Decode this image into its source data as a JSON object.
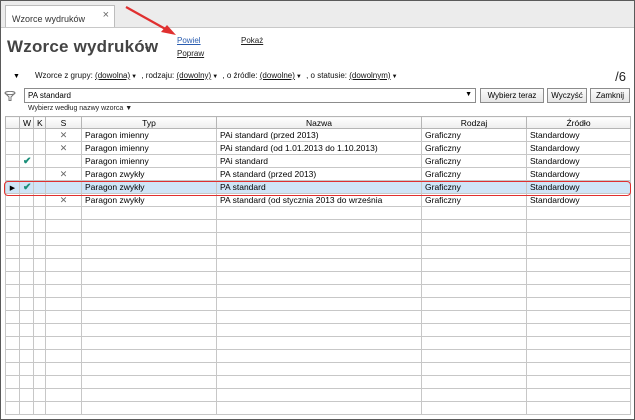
{
  "tab": {
    "label": "Wzorce wydruków",
    "close": "×"
  },
  "header": {
    "title": "Wzorce wydruków",
    "title_caret": "▾"
  },
  "actions": {
    "duplicate": "Powiel",
    "edit": "Popraw",
    "show": "Pokaż"
  },
  "page_count": "/6",
  "filters": {
    "group_label": "Wzorce z grupy:",
    "group_value": "(dowolna)",
    "type_label": ", rodzaju:",
    "type_value": "(dowolny)",
    "source_label": ", o źródle:",
    "source_value": "(dowolne)",
    "status_label": ", o statusie:",
    "status_value": "(dowolnym)"
  },
  "search": {
    "value": "PA standard",
    "select_now": "Wybierz teraz",
    "clear": "Wyczyść",
    "close": "Zamknij",
    "sublabel": "Wybierz według nazwy wzorca"
  },
  "table": {
    "columns": [
      "W",
      "K",
      "S",
      "Typ",
      "Nazwa",
      "Rodzaj",
      "Źródło"
    ],
    "rows": [
      {
        "w": "",
        "k": "",
        "s": "x",
        "typ": "Paragon imienny",
        "nazwa": "PAi standard (przed 2013)",
        "rodzaj": "Graficzny",
        "zrodlo": "Standardowy",
        "selected": false
      },
      {
        "w": "",
        "k": "",
        "s": "x",
        "typ": "Paragon imienny",
        "nazwa": "PAi standard (od 1.01.2013 do 1.10.2013)",
        "rodzaj": "Graficzny",
        "zrodlo": "Standardowy",
        "selected": false
      },
      {
        "w": "check",
        "k": "",
        "s": "",
        "typ": "Paragon imienny",
        "nazwa": "PAi standard",
        "rodzaj": "Graficzny",
        "zrodlo": "Standardowy",
        "selected": false
      },
      {
        "w": "",
        "k": "",
        "s": "x",
        "typ": "Paragon zwykły",
        "nazwa": "PA standard (przed 2013)",
        "rodzaj": "Graficzny",
        "zrodlo": "Standardowy",
        "selected": false
      },
      {
        "w": "check",
        "k": "",
        "s": "",
        "typ": "Paragon zwykły",
        "nazwa": "PA standard",
        "rodzaj": "Graficzny",
        "zrodlo": "Standardowy",
        "selected": true
      },
      {
        "w": "",
        "k": "",
        "s": "x",
        "typ": "Paragon zwykły",
        "nazwa": "PA standard (od stycznia 2013 do września",
        "rodzaj": "Graficzny",
        "zrodlo": "Standardowy",
        "selected": false
      }
    ],
    "empty_rows": 16
  },
  "colors": {
    "selection": "#cfe5f7",
    "highlight": "#e03030",
    "check": "#1a8f7a",
    "link": "#2a5db0"
  },
  "icons": {
    "close": "close-icon",
    "filter": "filter-icon",
    "check": "check-icon",
    "delete": "x-icon",
    "row_pointer": "row-pointer-icon"
  }
}
